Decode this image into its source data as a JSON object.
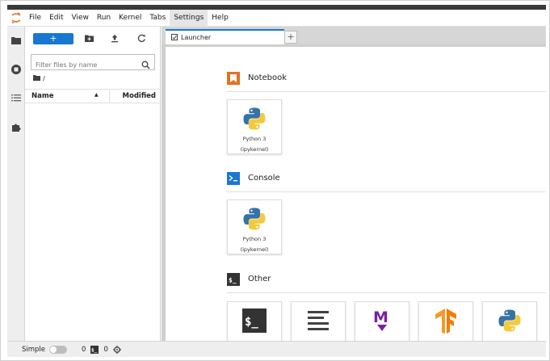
{
  "menu": {
    "items": [
      "File",
      "Edit",
      "View",
      "Run",
      "Kernel",
      "Tabs",
      "Settings",
      "Help"
    ],
    "active": "Settings"
  },
  "file_browser": {
    "new_label": "+",
    "filter_placeholder": "Filter files by name",
    "breadcrumb": "/",
    "columns": {
      "name": "Name",
      "modified": "Modified"
    },
    "sort_indicator": "▲"
  },
  "tabs": [
    {
      "label": "Launcher"
    }
  ],
  "tab_add_label": "+",
  "launcher": {
    "sections": {
      "notebook": {
        "title": "Notebook"
      },
      "console": {
        "title": "Console"
      },
      "other": {
        "title": "Other"
      }
    },
    "notebook_cards": [
      {
        "line1": "Python 3",
        "line2": "(ipykernel)"
      }
    ],
    "console_cards": [
      {
        "line1": "Python 3",
        "line2": "(ipykernel)"
      }
    ],
    "other_icons": [
      "terminal-icon",
      "text-file-icon",
      "markdown-icon",
      "tensorflow-icon",
      "python-file-icon"
    ],
    "colors": {
      "notebook": "#e66f23",
      "console": "#1976d2",
      "terminal": "#333333",
      "markdown": "#7b1fa2",
      "tensorflow": "#f59b26"
    }
  },
  "status": {
    "mode": "Simple",
    "count_a": "0",
    "count_b": "0"
  }
}
